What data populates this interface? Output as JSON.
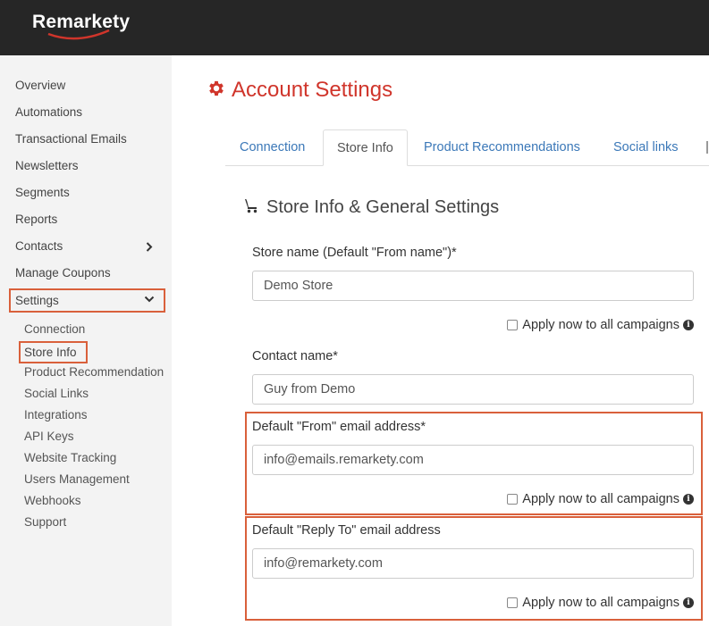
{
  "brand": {
    "logo_text": "Remarkety"
  },
  "sidebar": {
    "items": [
      {
        "label": "Overview"
      },
      {
        "label": "Automations"
      },
      {
        "label": "Transactional Emails"
      },
      {
        "label": "Newsletters"
      },
      {
        "label": "Segments"
      },
      {
        "label": "Reports"
      },
      {
        "label": "Contacts",
        "icon": "chevron-right-icon"
      },
      {
        "label": "Manage Coupons"
      },
      {
        "label": "Settings",
        "icon": "chevron-down-icon",
        "highlighted": true
      }
    ],
    "sub_items": [
      {
        "label": "Connection"
      },
      {
        "label": "Store Info",
        "active": true
      },
      {
        "label": "Product Recommendation"
      },
      {
        "label": "Social Links"
      },
      {
        "label": "Integrations"
      },
      {
        "label": "API Keys"
      },
      {
        "label": "Website Tracking"
      },
      {
        "label": "Users Management"
      },
      {
        "label": "Webhooks"
      },
      {
        "label": "Support"
      }
    ]
  },
  "page": {
    "title": "Account Settings",
    "title_icon": "gear-icon",
    "title_color": "#d0352b"
  },
  "tabs": [
    {
      "label": "Connection"
    },
    {
      "label": "Store Info",
      "active": true
    },
    {
      "label": "Product Recommendations"
    },
    {
      "label": "Social links"
    }
  ],
  "section": {
    "title": "Store Info & General Settings",
    "icon": "shopping-cart-icon"
  },
  "form": {
    "store_name": {
      "label": "Store name (Default \"From name\")*",
      "value": "Demo Store"
    },
    "contact_name": {
      "label": "Contact name*",
      "value": "Guy from Demo"
    },
    "from_email": {
      "label": "Default \"From\" email address*",
      "value": "info@emails.remarkety.com"
    },
    "reply_to_email": {
      "label": "Default \"Reply To\" email address",
      "value": "info@remarkety.com"
    },
    "apply_label": "Apply now to all campaigns"
  },
  "colors": {
    "accent": "#d0352b",
    "highlight_border": "#d9603b",
    "link": "#3b78b8",
    "topbar": "#262626",
    "sidebar_bg": "#f3f3f3"
  }
}
